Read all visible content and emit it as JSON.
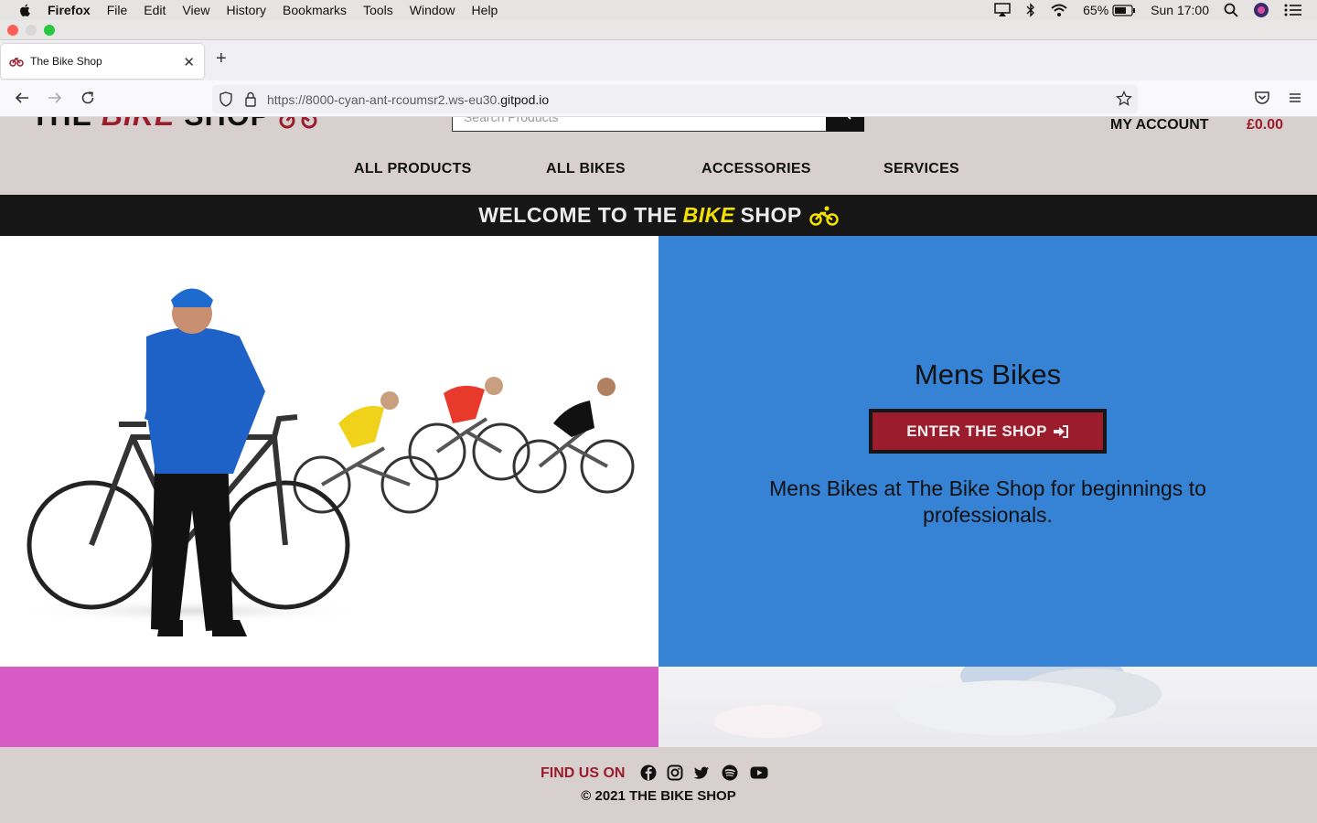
{
  "menubar": {
    "app": "Firefox",
    "items": [
      "File",
      "Edit",
      "View",
      "History",
      "Bookmarks",
      "Tools",
      "Window",
      "Help"
    ],
    "battery": "65%",
    "clock": "Sun 17:00"
  },
  "browser": {
    "tab_title": "The Bike Shop",
    "url_prefix": "https://8000-cyan-ant-rcoumsr2.ws-eu30.",
    "url_domain": "gitpod.io"
  },
  "site": {
    "logo_left": "THE",
    "logo_bike": "BIKE",
    "logo_right": "SHOP",
    "search_placeholder": "Search Products",
    "account": "MY ACCOUNT",
    "cart_total": "£0.00",
    "nav": [
      "ALL PRODUCTS",
      "ALL BIKES",
      "ACCESSORIES",
      "SERVICES"
    ],
    "banner": {
      "pre": "WELCOME TO THE",
      "bike": "BIKE",
      "post": "SHOP"
    },
    "hero": {
      "title": "Mens Bikes",
      "button": "ENTER THE SHOP",
      "description": "Mens Bikes at The Bike Shop for beginnings to professionals."
    },
    "footer": {
      "find_us": "FIND US ON",
      "social": [
        "facebook-icon",
        "instagram-icon",
        "twitter-icon",
        "spotify-icon",
        "youtube-icon"
      ],
      "copyright": "© 2021 THE BIKE SHOP"
    }
  },
  "colors": {
    "brand_red": "#9b1c2c",
    "banner_yellow": "#f5e100",
    "hero_blue": "#3683d6",
    "pink": "#d75bc4",
    "header_bg": "#d8d0cf"
  }
}
